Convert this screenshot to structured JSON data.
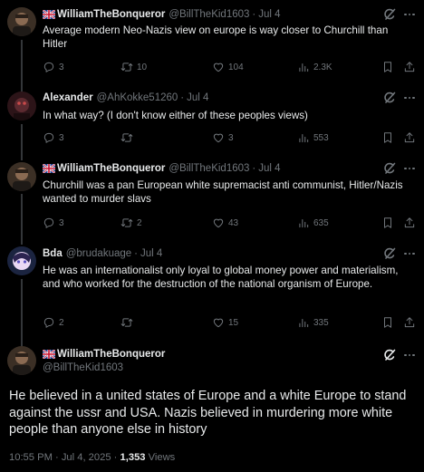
{
  "tweets": [
    {
      "name": "WilliamTheBonqueror",
      "handle": "@BillTheKid1603",
      "date": "Jul 4",
      "text": "Average modern Neo-Nazis view on europe is way closer to Churchill than Hitler",
      "replies": "3",
      "retweets": "10",
      "likes": "104",
      "views": "2.3K"
    },
    {
      "name": "Alexander",
      "handle": "@AhKokke51260",
      "date": "Jul 4",
      "text": "In what way? (I don't know either of these peoples views)",
      "replies": "3",
      "retweets": "",
      "likes": "3",
      "views": "553"
    },
    {
      "name": "WilliamTheBonqueror",
      "handle": "@BillTheKid1603",
      "date": "Jul 4",
      "text": "Churchill was a pan European white supremacist anti communist, Hitler/Nazis wanted to murder slavs",
      "replies": "3",
      "retweets": "2",
      "likes": "43",
      "views": "635"
    },
    {
      "name": "Bda",
      "handle": "@brudakuage",
      "date": "Jul 4",
      "text": "He was an internationalist only loyal to global money power and materialism, and who worked for the destruction of the national organism of Europe.",
      "replies": "2",
      "retweets": "",
      "likes": "15",
      "views": "335"
    }
  ],
  "main": {
    "name": "WilliamTheBonqueror",
    "handle": "@BillTheKid1603",
    "text": "He believed in a united states of Europe and a white Europe to stand against the ussr and USA. Nazis believed in murdering more white people than anyone else in history",
    "timestamp": "10:55 PM · Jul 4, 2025 · ",
    "views_count": "1,353",
    "views_label": " Views"
  },
  "colors": {
    "background": "#000000",
    "text": "#e7e9ea",
    "muted": "#71767b",
    "thread_line": "#333639"
  },
  "icons": [
    "reply-icon",
    "retweet-icon",
    "like-icon",
    "views-icon",
    "bookmark-icon",
    "share-icon",
    "grok-icon",
    "more-icon",
    "flag-icon"
  ]
}
